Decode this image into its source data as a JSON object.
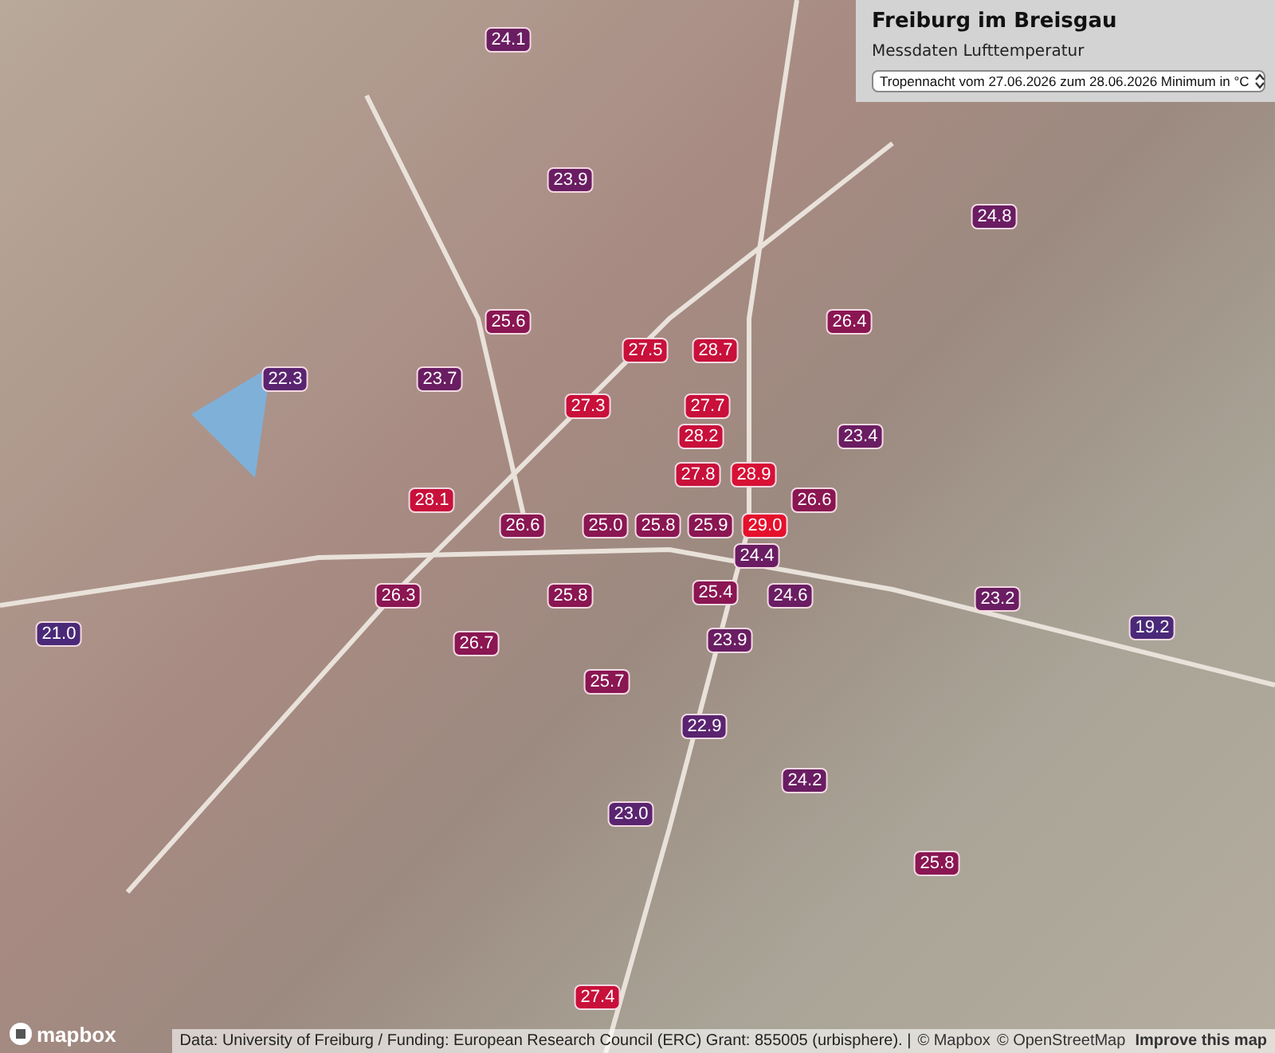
{
  "panel": {
    "title": "Freiburg im Breisgau",
    "subtitle": "Messdaten Lufttemperatur",
    "select": {
      "value": "Tropennacht vom 27.06.2026 zum 28.06.2026 Minimum in °C"
    }
  },
  "markers": [
    {
      "value": "24.1",
      "color": "#6a1d62"
    },
    {
      "value": "23.9",
      "color": "#6a1d62"
    },
    {
      "value": "24.8",
      "color": "#6a1d62"
    },
    {
      "value": "25.6",
      "color": "#8a1652"
    },
    {
      "value": "26.4",
      "color": "#8a1652"
    },
    {
      "value": "27.5",
      "color": "#c8103a"
    },
    {
      "value": "28.7",
      "color": "#c8103a"
    },
    {
      "value": "22.3",
      "color": "#5a2470"
    },
    {
      "value": "23.7",
      "color": "#6a1d62"
    },
    {
      "value": "27.3",
      "color": "#c8103a"
    },
    {
      "value": "27.7",
      "color": "#c8103a"
    },
    {
      "value": "28.2",
      "color": "#c8103a"
    },
    {
      "value": "23.4",
      "color": "#6a1d62"
    },
    {
      "value": "27.8",
      "color": "#c8103a"
    },
    {
      "value": "28.9",
      "color": "#d81035"
    },
    {
      "value": "28.1",
      "color": "#c8103a"
    },
    {
      "value": "26.6",
      "color": "#8a1652"
    },
    {
      "value": "26.6",
      "color": "#8a1652"
    },
    {
      "value": "25.0",
      "color": "#8a1652"
    },
    {
      "value": "25.8",
      "color": "#8a1652"
    },
    {
      "value": "25.9",
      "color": "#8a1652"
    },
    {
      "value": "29.0",
      "color": "#e5102c"
    },
    {
      "value": "24.4",
      "color": "#6a1d62"
    },
    {
      "value": "26.3",
      "color": "#8a1652"
    },
    {
      "value": "25.8",
      "color": "#8a1652"
    },
    {
      "value": "25.4",
      "color": "#8a1652"
    },
    {
      "value": "24.6",
      "color": "#6a1d62"
    },
    {
      "value": "23.2",
      "color": "#6a1d62"
    },
    {
      "value": "21.0",
      "color": "#4a2a78"
    },
    {
      "value": "26.7",
      "color": "#8a1652"
    },
    {
      "value": "23.9",
      "color": "#6a1d62"
    },
    {
      "value": "19.2",
      "color": "#4a2a78"
    },
    {
      "value": "25.7",
      "color": "#8a1652"
    },
    {
      "value": "22.9",
      "color": "#5a2470"
    },
    {
      "value": "24.2",
      "color": "#6a1d62"
    },
    {
      "value": "23.0",
      "color": "#5a2470"
    },
    {
      "value": "25.8",
      "color": "#8a1652"
    },
    {
      "value": "27.4",
      "color": "#c8103a"
    }
  ],
  "logo": {
    "label": "mapbox"
  },
  "attribution": {
    "text": "Data: University of Freiburg / Funding: European Research Council (ERC) Grant: 855005 (urbisphere). |",
    "links": [
      "© Mapbox",
      "© OpenStreetMap"
    ],
    "improve": "Improve this map"
  }
}
